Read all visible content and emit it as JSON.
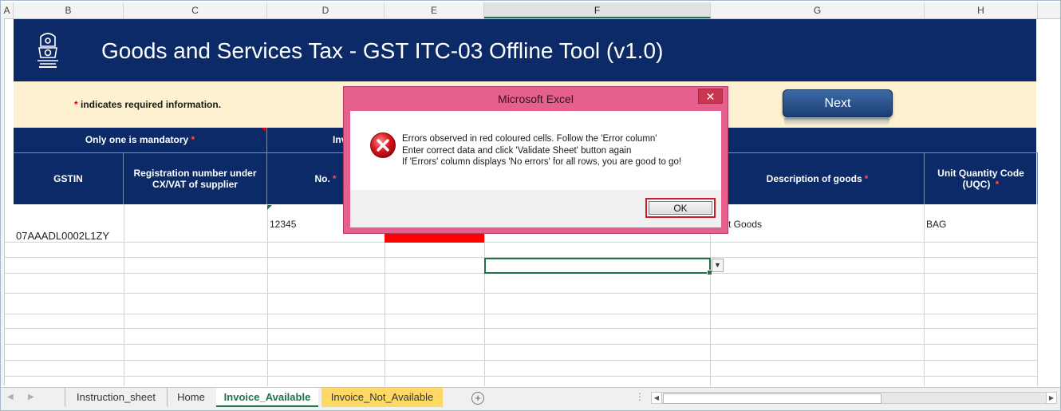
{
  "columns": [
    "A",
    "B",
    "C",
    "D",
    "E",
    "F",
    "G",
    "H"
  ],
  "banner": {
    "title": "Goods and Services Tax - GST ITC-03 Offline Tool (v1.0)"
  },
  "info": {
    "required_star": "*",
    "required_note": " indicates required information.",
    "next_label": "Next"
  },
  "header_row1": {
    "only_one": "Only one is mandatory ",
    "star": "*",
    "invoice_partial": "Inv"
  },
  "header_row2": {
    "gstin": "GSTIN",
    "registration": "Registration number under CX/VAT of supplier",
    "no": "No. ",
    "description": "Description of goods ",
    "uqc": "Unit Quantity Code (UQC) ",
    "star": "*"
  },
  "row1": {
    "gstin": "07AAADL0002L1ZY",
    "no": "12345",
    "description_partial": "t Goods",
    "uqc": "BAG"
  },
  "dialog": {
    "title": "Microsoft Excel",
    "close": "✕",
    "line1": "Errors observed in red coloured cells.  Follow the 'Error column'",
    "line2": "Enter correct data and click 'Validate Sheet' button again",
    "line3": "If 'Errors' column displays 'No errors' for all rows, you are good to go!",
    "ok_label": "OK",
    "icon": "error-icon"
  },
  "tabs": [
    {
      "label": "Instruction_sheet",
      "state": "normal"
    },
    {
      "label": "Home",
      "state": "normal"
    },
    {
      "label": "Invoice_Available",
      "state": "active"
    },
    {
      "label": "Invoice_Not_Available",
      "state": "highlighted"
    }
  ],
  "colors": {
    "banner": "#0b2a67",
    "info_strip": "#fdf1cf",
    "dialog_frame": "#e6608e",
    "error_fill": "#ff0000",
    "excel_green": "#217346"
  }
}
